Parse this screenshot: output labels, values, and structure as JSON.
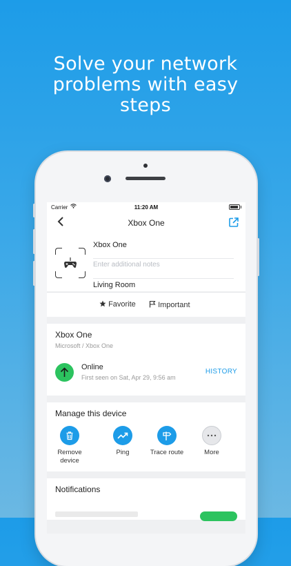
{
  "headline": {
    "line1": "Solve your network",
    "line2": "problems with easy",
    "line3": "steps"
  },
  "status_bar": {
    "carrier": "Carrier",
    "time": "11:20 AM",
    "battery_level": 0.9
  },
  "nav": {
    "title": "Xbox One"
  },
  "device": {
    "name": "Xbox One",
    "notes_placeholder": "Enter additional notes",
    "location": "Living Room"
  },
  "tags": {
    "favorite_label": "Favorite",
    "important_label": "Important"
  },
  "info": {
    "title": "Xbox One",
    "subtitle": "Microsoft / Xbox One",
    "status": "Online",
    "first_seen": "First seen on Sat, Apr 29, 9:56 am",
    "history_label": "HISTORY"
  },
  "manage": {
    "title": "Manage this device",
    "actions": [
      {
        "label_line1": "Remove",
        "label_line2": "device",
        "icon": "trash-icon"
      },
      {
        "label_line1": "Ping",
        "label_line2": "",
        "icon": "trend-up-icon"
      },
      {
        "label_line1": "Trace route",
        "label_line2": "",
        "icon": "signpost-icon"
      },
      {
        "label_line1": "More",
        "label_line2": "",
        "icon": "more-dots-icon"
      }
    ]
  },
  "notifications": {
    "title": "Notifications"
  },
  "colors": {
    "accent": "#1d9ce8",
    "online": "#2cc35f"
  }
}
